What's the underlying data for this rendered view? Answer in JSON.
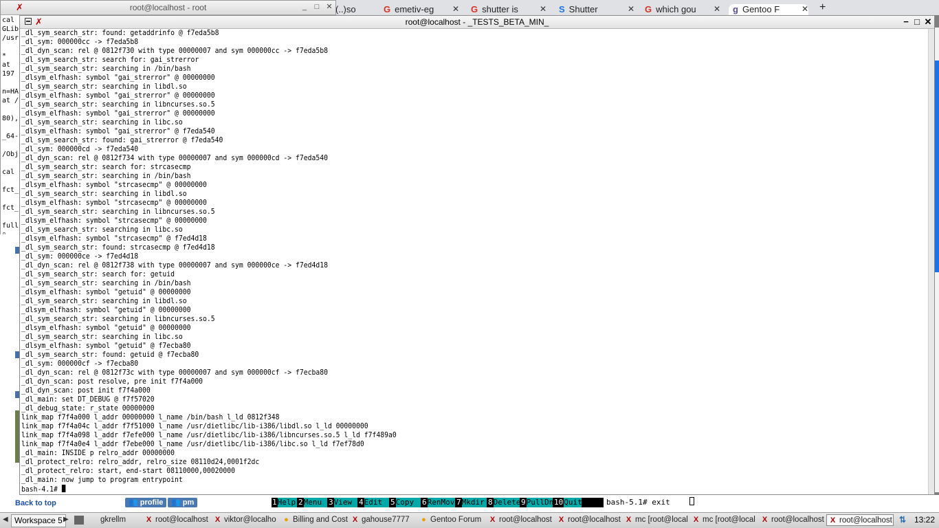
{
  "small_terminal": {
    "title": "root@localhost - root",
    "left_fragments": [
      "cal",
      "GLib",
      "/usr",
      "",
      "*",
      "at",
      "197",
      "",
      "n=HA",
      "at /",
      "",
      "80),",
      "",
      "_64-",
      "",
      "/Obj",
      "",
      "cal",
      "",
      "fct_",
      "",
      "fct_",
      "",
      "full",
      "▯"
    ]
  },
  "browser_tabs": [
    {
      "label": "(..)so",
      "icon": ""
    },
    {
      "label": "emetiv-eg",
      "icon": "G"
    },
    {
      "label": "shutter is",
      "icon": "G"
    },
    {
      "label": "Shutter",
      "icon": "S"
    },
    {
      "label": "which gou",
      "icon": "G"
    },
    {
      "label": "Gentoo F",
      "icon": "g"
    }
  ],
  "new_tab_label": "+",
  "terminal": {
    "title": "root@localhost - _TESTS_BETA_MIN_",
    "controls": {
      "minimize": "−",
      "maximize": "□",
      "close": "✕"
    },
    "lines": [
      "_dl_sym_search_str: found: getaddrinfo @ f7eda5b8",
      "_dl_sym: 000000cc -> f7eda5b8",
      "_dl_dyn_scan: rel @ 0812f730 with type 00000007 and sym 000000cc -> f7eda5b8",
      "_dl_sym_search_str: search for: gai_strerror",
      "_dl_sym_search_str: searching in /bin/bash",
      "_dlsym_elfhash: symbol \"gai_strerror\" @ 00000000",
      "_dl_sym_search_str: searching in libdl.so",
      "_dlsym_elfhash: symbol \"gai_strerror\" @ 00000000",
      "_dl_sym_search_str: searching in libncurses.so.5",
      "_dlsym_elfhash: symbol \"gai_strerror\" @ 00000000",
      "_dl_sym_search_str: searching in libc.so",
      "_dlsym_elfhash: symbol \"gai_strerror\" @ f7eda540",
      "_dl_sym_search_str: found: gai_strerror @ f7eda540",
      "_dl_sym: 000000cd -> f7eda540",
      "_dl_dyn_scan: rel @ 0812f734 with type 00000007 and sym 000000cd -> f7eda540",
      "_dl_sym_search_str: search for: strcasecmp",
      "_dl_sym_search_str: searching in /bin/bash",
      "_dlsym_elfhash: symbol \"strcasecmp\" @ 00000000",
      "_dl_sym_search_str: searching in libdl.so",
      "_dlsym_elfhash: symbol \"strcasecmp\" @ 00000000",
      "_dl_sym_search_str: searching in libncurses.so.5",
      "_dlsym_elfhash: symbol \"strcasecmp\" @ 00000000",
      "_dl_sym_search_str: searching in libc.so",
      "_dlsym_elfhash: symbol \"strcasecmp\" @ f7ed4d18",
      "_dl_sym_search_str: found: strcasecmp @ f7ed4d18",
      "_dl_sym: 000000ce -> f7ed4d18",
      "_dl_dyn_scan: rel @ 0812f738 with type 00000007 and sym 000000ce -> f7ed4d18",
      "_dl_sym_search_str: search for: getuid",
      "_dl_sym_search_str: searching in /bin/bash",
      "_dlsym_elfhash: symbol \"getuid\" @ 00000000",
      "_dl_sym_search_str: searching in libdl.so",
      "_dlsym_elfhash: symbol \"getuid\" @ 00000000",
      "_dl_sym_search_str: searching in libncurses.so.5",
      "_dlsym_elfhash: symbol \"getuid\" @ 00000000",
      "_dl_sym_search_str: searching in libc.so",
      "_dlsym_elfhash: symbol \"getuid\" @ f7ecba80",
      "_dl_sym_search_str: found: getuid @ f7ecba80",
      "_dl_sym: 000000cf -> f7ecba80",
      "_dl_dyn_scan: rel @ 0812f73c with type 00000007 and sym 000000cf -> f7ecba80",
      "_dl_dyn_scan: post resolve, pre init f7f4a000",
      "_dl_dyn_scan: post init f7f4a000",
      "_dl_main: set DT_DEBUG @ f7f57020",
      "_dl_debug_state: r_state 00000000",
      "link_map f7f4a000 l_addr 00000000 l_name /bin/bash l_ld 0812f348",
      "link_map f7f4a04c l_addr f7f51000 l_name /usr/dietlibc/lib-i386/libdl.so l_ld 00000000",
      "link_map f7f4a098 l_addr f7efe000 l_name /usr/dietlibc/lib-i386/libncurses.so.5 l_ld f7f489a0",
      "link_map f7f4a0e4 l_addr f7ebe000 l_name /usr/dietlibc/lib-i386/libc.so l_ld f7ef78d0",
      "_dl_main: INSIDE p relro_addr 00000000",
      "_dl_protect_relro: relro_addr, relro_size 08110d24,0001f2dc",
      "_dl_protect_relro: start, end-start 08110000,00020000",
      "_dl_main: now jump to program entrypoint"
    ],
    "prompt": "bash-4.1# "
  },
  "below_strip": {
    "back_to_top": "Back to top",
    "profile": "profile",
    "pm": "pm"
  },
  "mc_fkeys": [
    {
      "num": "1",
      "label": "Help"
    },
    {
      "num": "2",
      "label": "Menu"
    },
    {
      "num": "3",
      "label": "View"
    },
    {
      "num": "4",
      "label": "Edit"
    },
    {
      "num": "5",
      "label": "Copy"
    },
    {
      "num": "6",
      "label": "RenMov"
    },
    {
      "num": "7",
      "label": "Mkdir"
    },
    {
      "num": "8",
      "label": "Delete"
    },
    {
      "num": "9",
      "label": "PullDn"
    },
    {
      "num": "10",
      "label": "Quit"
    }
  ],
  "mc_prompt": "bash-5.1# exit",
  "taskbar": {
    "workspace": "Workspace 5",
    "tasks": [
      {
        "label": "gkrellm",
        "icon": ""
      },
      {
        "label": "root@localhost",
        "icon": "X"
      },
      {
        "label": "viktor@localho",
        "icon": "X"
      },
      {
        "label": "Billing and Cost",
        "icon": "●"
      },
      {
        "label": "gahouse7777",
        "icon": "X"
      },
      {
        "label": "Gentoo Forum",
        "icon": "●"
      },
      {
        "label": "root@localhost",
        "icon": "X"
      },
      {
        "label": "root@localhost",
        "icon": "X"
      },
      {
        "label": "mc [root@local",
        "icon": "X"
      },
      {
        "label": "mc [root@local",
        "icon": "X"
      },
      {
        "label": "root@localhost",
        "icon": "X"
      },
      {
        "label": "root@localhost",
        "icon": "X"
      }
    ],
    "clock": "13:22"
  },
  "colors": {
    "mc_cyan": "#00a8a8",
    "task_icon_red": "#b00000",
    "link_blue": "#1a4fa0"
  }
}
